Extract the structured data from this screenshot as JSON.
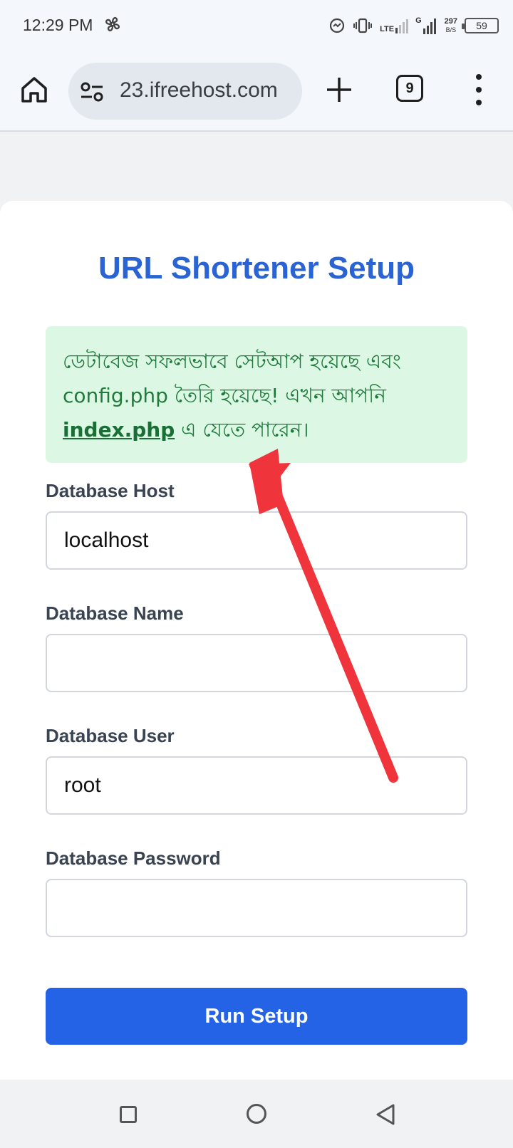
{
  "status_bar": {
    "time": "12:29 PM",
    "network_label": "LTE",
    "network_sub": "G",
    "speed_value": "297",
    "speed_unit": "B/S",
    "battery": "59"
  },
  "browser": {
    "url": "23.ifreehost.com",
    "tab_count": "9"
  },
  "page": {
    "title": "URL Shortener Setup",
    "alert": {
      "line1": "ডেটাবেজ সফলভাবে সেটআপ হয়েছে এবং",
      "line2": "config.php তৈরি হয়েছে! এখন আপনি",
      "link_text": "index.php",
      "line3_rest": " এ যেতে পারেন।"
    },
    "form": {
      "host_label": "Database Host",
      "host_value": "localhost",
      "name_label": "Database Name",
      "name_value": "",
      "user_label": "Database User",
      "user_value": "root",
      "password_label": "Database Password",
      "password_value": "",
      "submit_label": "Run Setup"
    }
  },
  "colors": {
    "title": "#2a63d4",
    "button": "#2563e6",
    "alert_bg": "#dcf8e4",
    "alert_text": "#1f7a3c",
    "arrow": "#f0343b"
  }
}
